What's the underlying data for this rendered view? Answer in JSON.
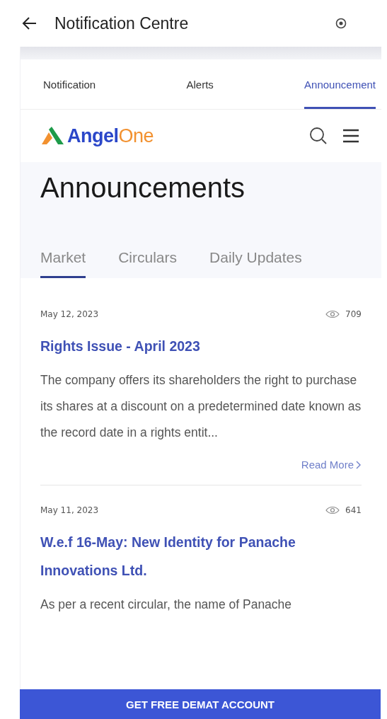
{
  "app_bar": {
    "title": "Notification Centre"
  },
  "tabs": [
    {
      "label": "Notification",
      "selected": false
    },
    {
      "label": "Alerts",
      "selected": false
    },
    {
      "label": "Announcement",
      "selected": true
    }
  ],
  "site_header": {
    "logo": {
      "part_1": "Angel",
      "part_2": "One"
    }
  },
  "hero": {
    "title": "Announcements",
    "tabs": [
      {
        "label": "Market",
        "selected": true
      },
      {
        "label": "Circulars",
        "selected": false
      },
      {
        "label": "Daily Updates",
        "selected": false
      }
    ]
  },
  "articles": [
    {
      "date": "May 12, 2023",
      "views": "709",
      "title": "Rights Issue - April 2023",
      "summary": "The company offers its shareholders the right to purchase its shares at a discount on a predetermined date known as the record date in a rights entit...",
      "link": "Read More"
    },
    {
      "date": "May 11, 2023",
      "views": "641",
      "title": "W.e.f 16-May: New Identity for Panache Innovations Ltd.",
      "summary": "As per a recent circular, the name of Panache"
    }
  ],
  "cta": {
    "label": "GET FREE DEMAT ACCOUNT"
  }
}
